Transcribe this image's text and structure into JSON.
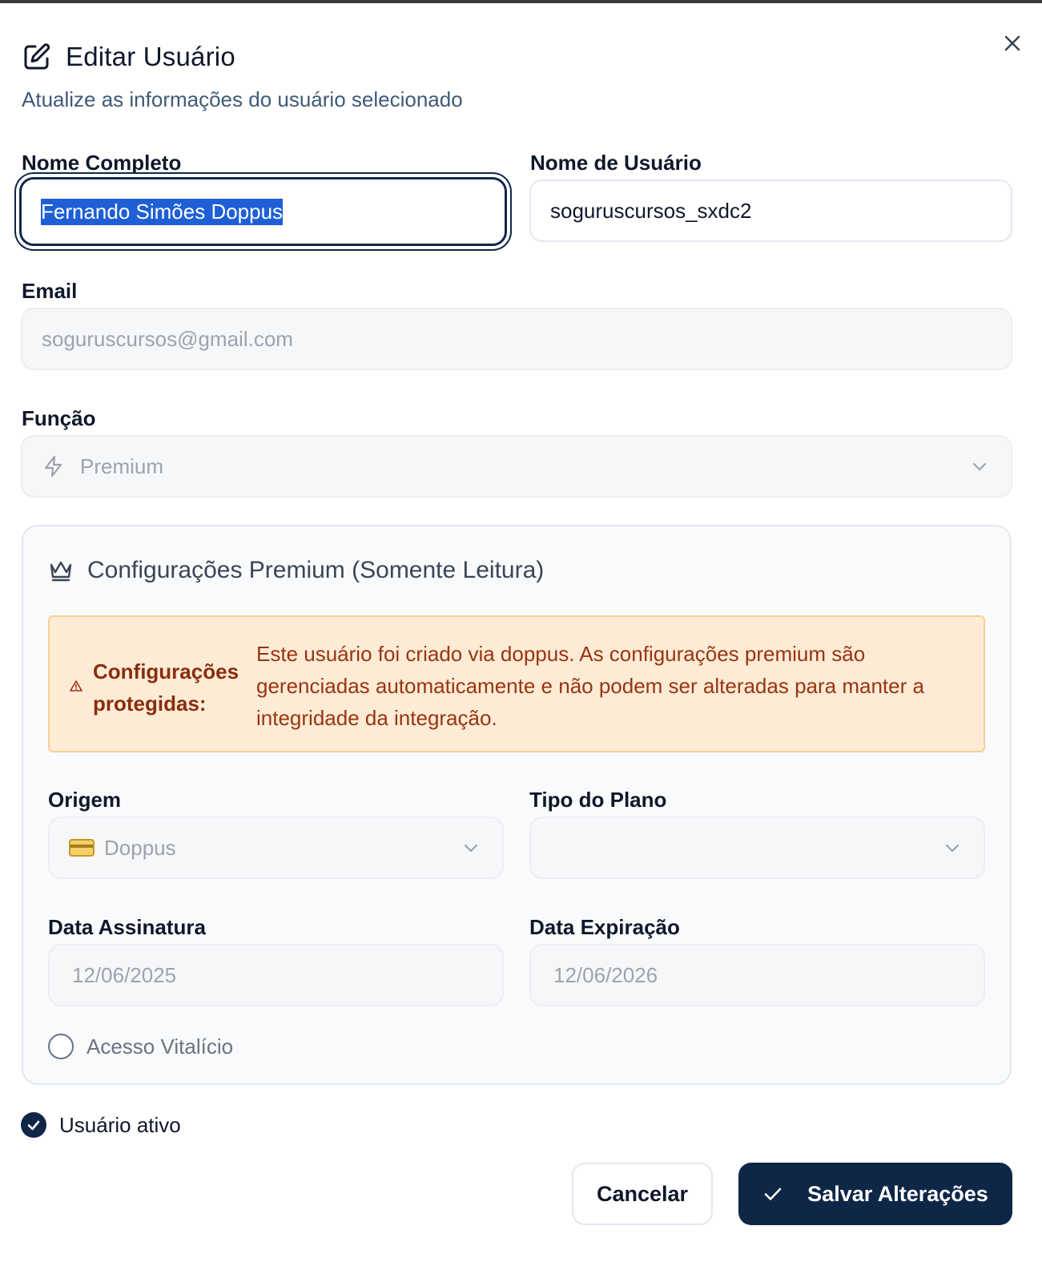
{
  "dialog": {
    "title": "Editar Usuário",
    "subtitle": "Atualize as informações do usuário selecionado",
    "close_icon": "close-icon"
  },
  "form": {
    "full_name_label": "Nome Completo",
    "full_name_value": "Fernando Simões Doppus",
    "username_label": "Nome de Usuário",
    "username_value": "soguruscursos_sxdc2",
    "email_label": "Email",
    "email_value": "soguruscursos@gmail.com",
    "role_label": "Função",
    "role_value": "Premium"
  },
  "premium": {
    "title": "Configurações Premium (Somente Leitura)",
    "alert_head": "Configurações protegidas:",
    "alert_text": "Este usuário foi criado via doppus. As configurações premium são gerenciadas automaticamente e não podem ser alteradas para manter a integridade da integração.",
    "origin_label": "Origem",
    "origin_value": "Doppus",
    "plan_type_label": "Tipo do Plano",
    "plan_type_value": "",
    "subscription_date_label": "Data Assinatura",
    "subscription_date_value": "12/06/2025",
    "expiration_date_label": "Data Expiração",
    "expiration_date_value": "12/06/2026",
    "lifetime_label": "Acesso Vitalício",
    "lifetime_checked": false
  },
  "active": {
    "label": "Usuário ativo",
    "checked": true
  },
  "buttons": {
    "cancel": "Cancelar",
    "save": "Salvar Alterações"
  },
  "colors": {
    "primary": "#0f2747",
    "alert_bg": "#fdebd5",
    "alert_text": "#9a3412"
  }
}
